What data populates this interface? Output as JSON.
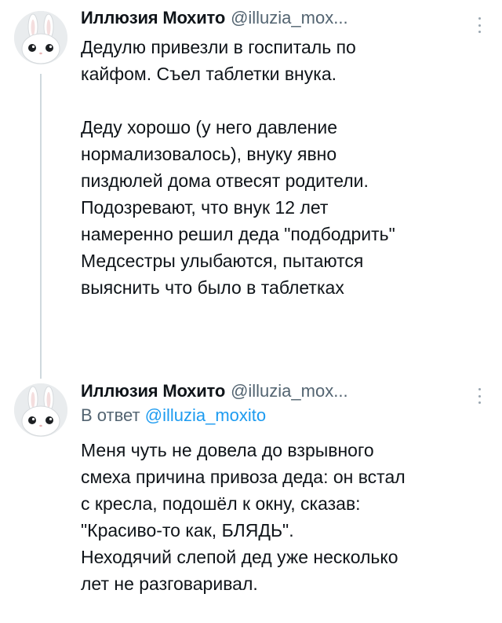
{
  "tweets": [
    {
      "author_name": "Иллюзия Мохито",
      "author_handle": "@illuzia_mox...",
      "body": "Дедулю привезли в госпиталь по\nкайфом. Съел таблетки внука.\n\nДеду хорошо (у него давление\nнормализовалось), внуку явно\nпиздюлей дома отвесят родители.\nПодозревают, что внук 12 лет\nнамеренно решил деда \"подбодрить\"\nМедсестры улыбаются, пытаются\nвыяснить что было в таблетках"
    },
    {
      "author_name": "Иллюзия Мохито",
      "author_handle": "@illuzia_mox...",
      "reply_prefix": "В ответ",
      "reply_mention": "@illuzia_moxito",
      "body": "Меня чуть не довела до взрывного\nсмеха причина привоза деда: он встал\nс кресла, подошёл к окну, сказав:\n\"Красиво-то как, БЛЯДЬ\".\nНеходячий слепой дед уже несколько\nлет не разговаривал."
    }
  ],
  "icons": {
    "avatar": "white-rabbit-avatar",
    "more": "vertical-ellipsis-icon"
  },
  "colors": {
    "text": "#0f1419",
    "secondary": "#536471",
    "link": "#1d9bf0",
    "thread_line": "#cfd9de"
  }
}
